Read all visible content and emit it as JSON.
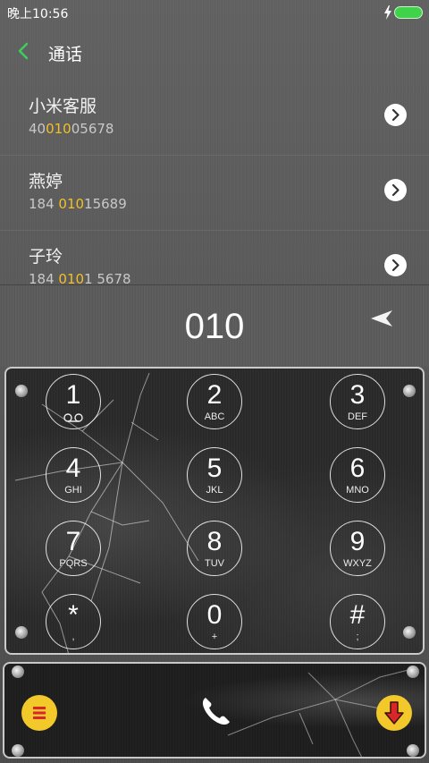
{
  "status_bar": {
    "time": "晚上10:56",
    "charging_icon": "bolt-icon",
    "battery_icon": "battery-icon",
    "battery_color": "#41d24c"
  },
  "header": {
    "back_icon": "chevron-left-icon",
    "title": "通话"
  },
  "results": [
    {
      "name": "小米客服",
      "number_prefix": "40",
      "number_match": "010",
      "number_suffix": "05678"
    },
    {
      "name": "燕婷",
      "number_prefix": "184 ",
      "number_match": "010",
      "number_suffix": "15689"
    },
    {
      "name": "子玲",
      "number_prefix": "184 ",
      "number_match": "010",
      "number_suffix": "1 5678"
    }
  ],
  "dialer": {
    "input_value": "010",
    "delete_icon": "backspace-arrow-icon"
  },
  "keypad": [
    {
      "digit": "1",
      "letters": ""
    },
    {
      "digit": "2",
      "letters": "ABC"
    },
    {
      "digit": "3",
      "letters": "DEF"
    },
    {
      "digit": "4",
      "letters": "GHI"
    },
    {
      "digit": "5",
      "letters": "JKL"
    },
    {
      "digit": "6",
      "letters": "MNO"
    },
    {
      "digit": "7",
      "letters": "PQRS"
    },
    {
      "digit": "8",
      "letters": "TUV"
    },
    {
      "digit": "9",
      "letters": "WXYZ"
    },
    {
      "digit": "*",
      "letters": ","
    },
    {
      "digit": "0",
      "letters": "+"
    },
    {
      "digit": "#",
      "letters": ";"
    }
  ],
  "actions": {
    "menu_icon": "menu-icon",
    "call_icon": "phone-icon",
    "hide_icon": "arrow-down-icon"
  },
  "colors": {
    "accent": "#f2c026",
    "back_arrow": "#3ccf5a",
    "button_yellow": "#f3c82b"
  }
}
